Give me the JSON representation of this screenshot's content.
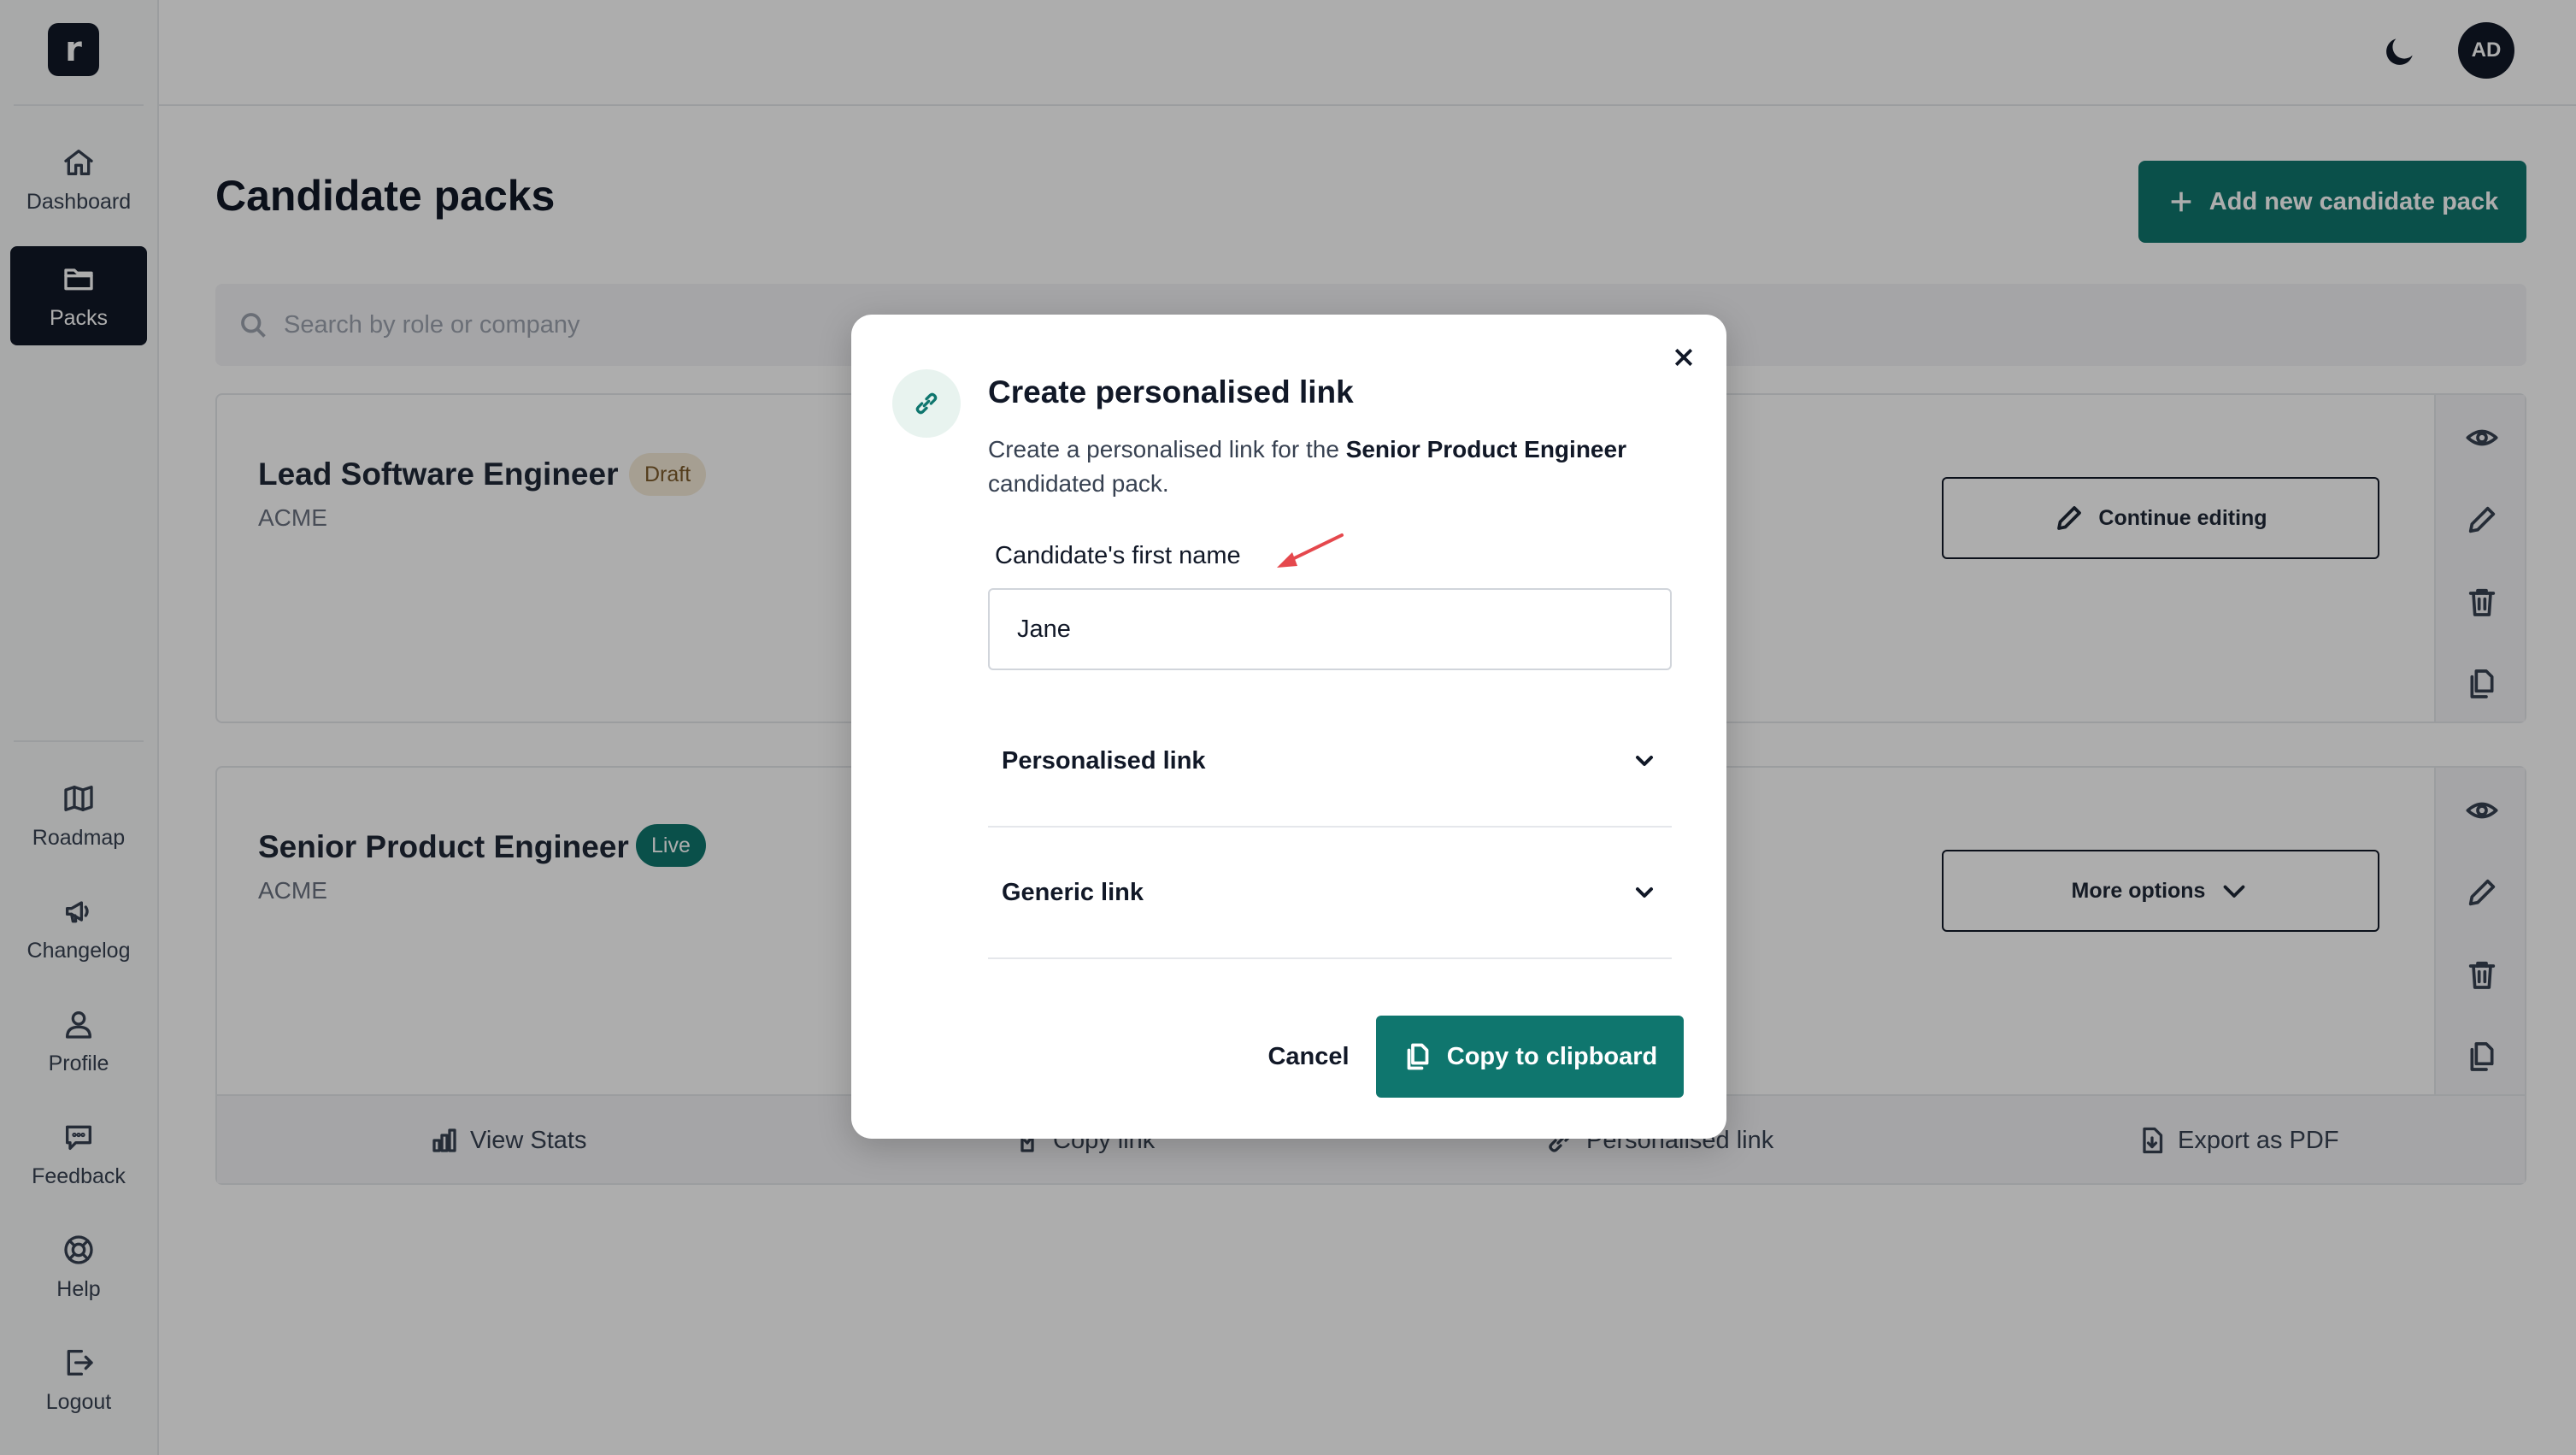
{
  "sidebar": {
    "logo": "r",
    "items": [
      {
        "label": "Dashboard",
        "icon": "home-icon"
      },
      {
        "label": "Packs",
        "icon": "folder-icon",
        "active": true
      },
      {
        "label": "Roadmap",
        "icon": "map-icon"
      },
      {
        "label": "Changelog",
        "icon": "megaphone-icon"
      },
      {
        "label": "Profile",
        "icon": "user-icon"
      },
      {
        "label": "Feedback",
        "icon": "chat-icon"
      },
      {
        "label": "Help",
        "icon": "lifebuoy-icon"
      },
      {
        "label": "Logout",
        "icon": "logout-icon"
      }
    ]
  },
  "topbar": {
    "theme_icon": "moon-icon",
    "avatar_initials": "AD"
  },
  "main": {
    "title": "Candidate packs",
    "add_button": "Add new candidate pack",
    "search_placeholder": "Search by role or company",
    "cards": [
      {
        "title": "Lead Software Engineer",
        "badge": "Draft",
        "company": "ACME",
        "action": "Continue editing"
      },
      {
        "title": "Senior Product Engineer",
        "badge": "Live",
        "company": "ACME",
        "action": "More options",
        "footer": [
          "View Stats",
          "Copy link",
          "Personalised link",
          "Export as PDF"
        ]
      }
    ]
  },
  "modal": {
    "title": "Create personalised link",
    "desc_prefix": "Create a personalised link for the ",
    "desc_bold": "Senior Product Engineer",
    "desc_suffix": "candidated pack.",
    "field_label": "Candidate's first name",
    "field_value": "Jane",
    "accordions": [
      "Personalised link",
      "Generic link"
    ],
    "cancel": "Cancel",
    "copy": "Copy to clipboard"
  },
  "colors": {
    "accent": "#0f766e",
    "draft_badge": "#f5ead7",
    "annotation_arrow": "#e5484d"
  }
}
